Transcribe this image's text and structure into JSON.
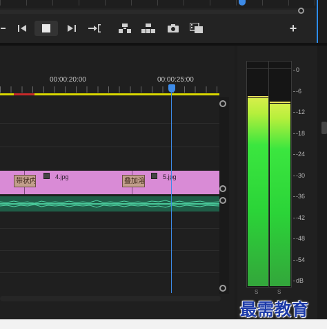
{
  "program_monitor": {
    "transport": {
      "buttons": [
        {
          "name": "step-back",
          "icon": "step-back-icon"
        },
        {
          "name": "stop",
          "icon": "stop-icon"
        },
        {
          "name": "step-forward",
          "icon": "step-forward-icon"
        },
        {
          "name": "go-to-out",
          "icon": "go-to-out-point-icon"
        },
        {
          "name": "lift",
          "icon": "lift-icon"
        },
        {
          "name": "extract",
          "icon": "extract-icon"
        },
        {
          "name": "export-frame",
          "icon": "camera-icon"
        },
        {
          "name": "comparison-view",
          "icon": "comparison-view-icon"
        },
        {
          "name": "button-editor",
          "icon": "plus-icon",
          "label": "+"
        }
      ]
    }
  },
  "timeline": {
    "timecodes": [
      "00:00:20:00",
      "00:00:25:00"
    ],
    "video_track": {
      "clips": [
        {
          "name": "4.jpg",
          "fx": "fx-badge-icon"
        },
        {
          "name": "5.jpg",
          "fx": "fx-badge-icon"
        }
      ],
      "transitions": [
        "带状内",
        "叠加溶"
      ]
    },
    "accent": "#3d8be8",
    "work_area_color": "#d9d700",
    "video_clip_color": "#d98bd6",
    "audio_clip_color": "#1f5d47"
  },
  "audio_meters": {
    "scale": [
      "0",
      "-6",
      "-12",
      "-18",
      "-24",
      "-30",
      "-36",
      "-42",
      "-48",
      "-54",
      "dB"
    ],
    "channels": [
      {
        "label": "S",
        "level_db": -7.5
      },
      {
        "label": "S",
        "level_db": -9
      }
    ]
  },
  "watermark": "最需教育"
}
